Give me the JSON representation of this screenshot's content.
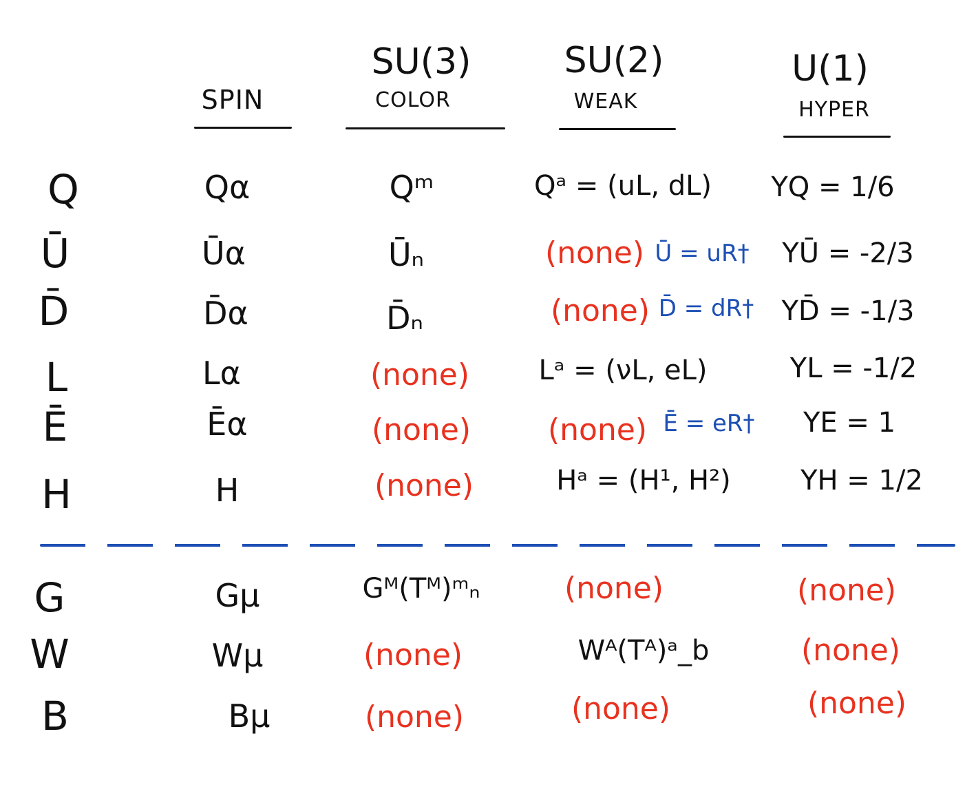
{
  "headers": {
    "spin": "SPIN",
    "color": {
      "top": "SU(3)",
      "sub": "COLOR"
    },
    "weak": {
      "top": "SU(2)",
      "sub": "WEAK"
    },
    "hyper": {
      "top": "U(1)",
      "sub": "HYPER"
    }
  },
  "fermions": [
    {
      "name": "Q",
      "spin": "Qα",
      "color": "Qᵐ",
      "weak": "Qᵃ = (uL, dL)",
      "weak_note": "",
      "hyper": "YQ = 1/6"
    },
    {
      "name": "Ū",
      "spin": "Ūα",
      "color": "Ūₙ",
      "weak": "(none)",
      "weak_note": "Ū = uR†",
      "hyper": "YŪ = -2/3"
    },
    {
      "name": "D̄",
      "spin": "D̄α",
      "color": "D̄ₙ",
      "weak": "(none)",
      "weak_note": "D̄ = dR†",
      "hyper": "YD̄ = -1/3"
    },
    {
      "name": "L",
      "spin": "Lα",
      "color": "(none)",
      "weak": "Lᵃ = (νL, eL)",
      "weak_note": "",
      "hyper": "YL = -1/2"
    },
    {
      "name": "Ē",
      "spin": "Ēα",
      "color": "(none)",
      "weak": "(none)",
      "weak_note": "Ē = eR†",
      "hyper": "YE = 1"
    },
    {
      "name": "H",
      "spin": "H",
      "color": "(none)",
      "weak": "Hᵃ = (H¹, H²)",
      "weak_note": "",
      "hyper": "YH = 1/2"
    }
  ],
  "bosons": [
    {
      "name": "G",
      "spin": "Gμ",
      "color": "Gᴹ(Tᴹ)ᵐₙ",
      "weak": "(none)",
      "hyper": "(none)"
    },
    {
      "name": "W",
      "spin": "Wμ",
      "color": "(none)",
      "weak": "Wᴬ(Tᴬ)ᵃ_b",
      "hyper": "(none)"
    },
    {
      "name": "B",
      "spin": "Bμ",
      "color": "(none)",
      "weak": "(none)",
      "hyper": "(none)"
    }
  ],
  "colors": {
    "ink": "#111111",
    "none": "#e8321f",
    "note": "#1d4fb5"
  }
}
